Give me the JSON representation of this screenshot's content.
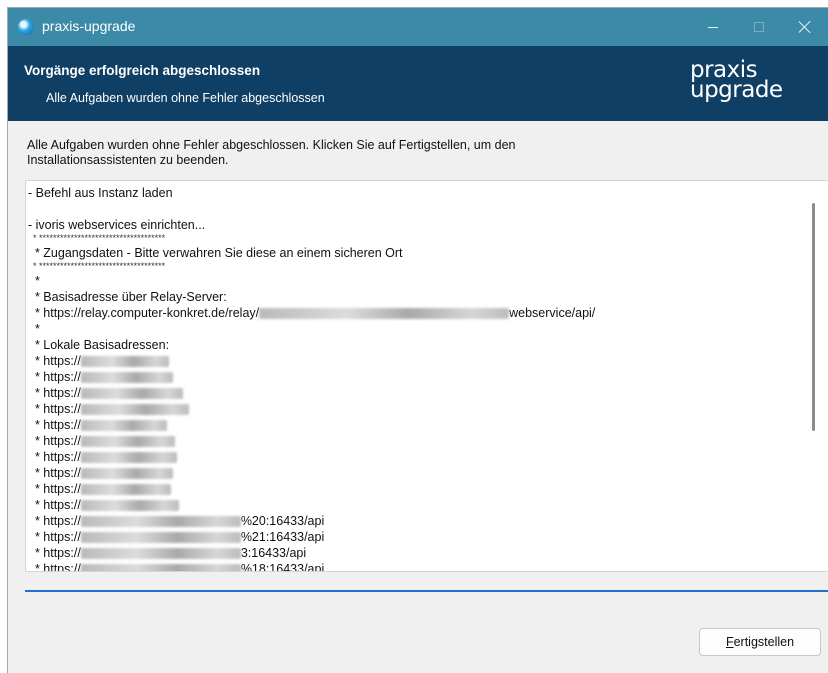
{
  "window": {
    "title": "praxis-upgrade",
    "controls": {
      "minimize": "minimize",
      "maximize": "maximize",
      "close": "close"
    }
  },
  "banner": {
    "title": "Vorgänge erfolgreich abgeschlossen",
    "subtitle": "Alle Aufgaben wurden ohne Fehler abgeschlossen",
    "logo_line1": "praxis",
    "logo_line2": "upgrade"
  },
  "intro_text": "Alle Aufgaben wurden ohne Fehler abgeschlossen. Klicken Sie auf Fertigstellen, um den Installationsassistenten zu beenden.",
  "log": {
    "lines": [
      "- Befehl aus Instanz laden",
      "",
      "- ivoris webservices einrichten...",
      "  * ************************************",
      "  * Zugangsdaten - Bitte verwahren Sie diese an einem sicheren Ort",
      "  * ************************************",
      "  *",
      "  * Basisadresse über Relay-Server:",
      "  * https://relay.computer-konkret.de/relay/",
      "  *",
      "  * Lokale Basisadressen:",
      "  * https://",
      "  * https://",
      "  * https://",
      "  * https://",
      "  * https://",
      "  * https://",
      "  * https://",
      "  * https://",
      "  * https://",
      "  * https://",
      "  * https://",
      "  * https://",
      "  * https://",
      "  * https://"
    ],
    "relay_suffix": "webservice/api/",
    "url_suffixes": [
      "%20:16433/api",
      "%21:16433/api",
      "3:16433/api",
      "%18:16433/api"
    ]
  },
  "buttons": {
    "finish_mnemonic": "F",
    "finish_rest": "ertigstellen"
  },
  "colors": {
    "titlebar": "#3b8aa8",
    "banner": "#0f3f64",
    "accent_line": "#1f73c8"
  }
}
